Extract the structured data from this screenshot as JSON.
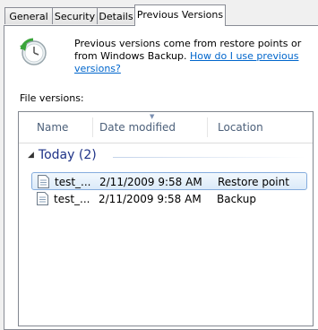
{
  "tabs": [
    {
      "label": "General"
    },
    {
      "label": "Security"
    },
    {
      "label": "Details"
    },
    {
      "label": "Previous Versions",
      "active": true
    }
  ],
  "info": {
    "text": "Previous versions come from restore points or from Windows Backup.",
    "link": "How do I use previous versions?"
  },
  "file_versions_label": "File versions:",
  "columns": [
    "Name",
    "Date modified",
    "Location"
  ],
  "group": {
    "label": "Today (2)",
    "expanded": true
  },
  "rows": [
    {
      "name": "test_...",
      "date": "2/11/2009 9:58 AM",
      "location": "Restore point",
      "selected": true
    },
    {
      "name": "test_...",
      "date": "2/11/2009 9:58 AM",
      "location": "Backup",
      "selected": false
    }
  ],
  "icons": {
    "info": "restore-clock-icon",
    "file": "document-icon",
    "group_toggle": "collapse-triangle-icon",
    "sort": "sort-descending-icon"
  },
  "colors": {
    "link": "#0066cc",
    "group_header": "#1e3287",
    "column_header": "#4c607a",
    "selection_border": "#84acdd"
  }
}
